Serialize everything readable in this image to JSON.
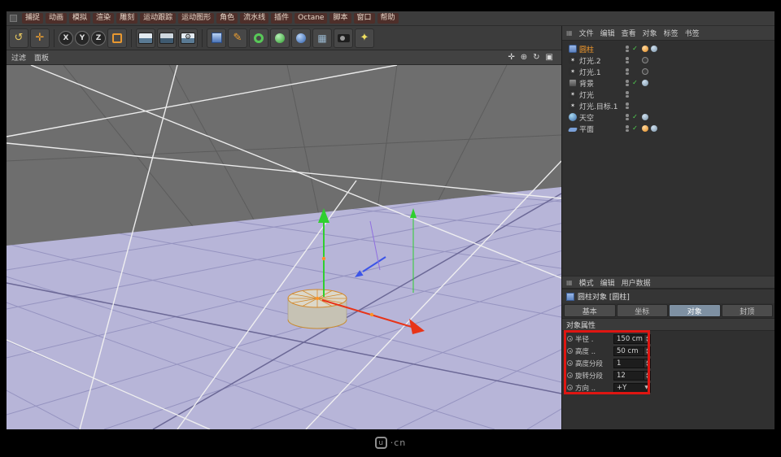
{
  "menubar": {
    "items": [
      "捕捉",
      "动画",
      "模拟",
      "渲染",
      "雕刻",
      "运动跟踪",
      "运动图形",
      "角色",
      "流水线",
      "插件",
      "Octane",
      "脚本",
      "窗口",
      "帮助"
    ]
  },
  "toolbar": {
    "axis": [
      "X",
      "Y",
      "Z"
    ],
    "icons": [
      "undo",
      "move-tool",
      "x-lock",
      "y-lock",
      "z-lock",
      "coordinate-system",
      "render-view",
      "render-region",
      "render-settings",
      "primitive-cube",
      "pen-tool",
      "spline-tool",
      "generator",
      "volume",
      "array",
      "camera",
      "light"
    ]
  },
  "viewport": {
    "menus": [
      "过滤",
      "面板"
    ],
    "nav_icons": [
      "pan",
      "zoom",
      "rotate",
      "maximize"
    ]
  },
  "object_manager": {
    "menus": [
      "文件",
      "编辑",
      "查看",
      "对象",
      "标签",
      "书签"
    ],
    "objects": [
      {
        "name": "圆柱",
        "icon": "cylinder-icon",
        "selected": true,
        "check": true,
        "tags": [
          "phong-tag",
          "compositing-tag"
        ]
      },
      {
        "name": "灯光.2",
        "icon": "light-icon",
        "check": false,
        "tags": [
          "target-tag"
        ]
      },
      {
        "name": "灯光.1",
        "icon": "light-icon",
        "check": false,
        "tags": [
          "target-tag"
        ]
      },
      {
        "name": "背景",
        "icon": "background-icon",
        "check": true,
        "tags": [
          "compositing-tag"
        ]
      },
      {
        "name": "灯光",
        "icon": "light-icon",
        "check": false,
        "tags": []
      },
      {
        "name": "灯光.目标.1",
        "icon": "light-icon",
        "check": false,
        "tags": []
      },
      {
        "name": "天空",
        "icon": "sky-icon",
        "check": true,
        "tags": [
          "compositing-tag"
        ]
      },
      {
        "name": "平面",
        "icon": "plane-icon",
        "check": true,
        "tags": [
          "phong-tag",
          "compositing-tag"
        ]
      }
    ]
  },
  "attribute_manager": {
    "menus": [
      "模式",
      "编辑",
      "用户数据"
    ],
    "title": "圆柱对象 [圆柱]",
    "tabs": [
      {
        "label": "基本",
        "active": false
      },
      {
        "label": "坐标",
        "active": false
      },
      {
        "label": "对象",
        "active": true
      },
      {
        "label": "封顶",
        "active": false
      }
    ],
    "section": "对象属性",
    "properties": [
      {
        "label": "半径 .",
        "value": "150 cm",
        "type": "number"
      },
      {
        "label": "高度 ..",
        "value": "50 cm",
        "type": "number"
      },
      {
        "label": "高度分段",
        "value": "1",
        "type": "number"
      },
      {
        "label": "旋转分段",
        "value": "12",
        "type": "number"
      },
      {
        "label": "方向 ..",
        "value": "+Y",
        "type": "select"
      }
    ]
  },
  "icons": {
    "undo": "↺",
    "move": "✛",
    "gear": "⚙",
    "pen": "✎",
    "grid": "▦",
    "light": "✦",
    "pan": "✛",
    "zoom": "⊕",
    "rotate": "↻",
    "maximize": "▣",
    "check": "✓",
    "dropdown": "▼",
    "stepper_up": "▴",
    "stepper_down": "▾",
    "panel_menu": "▦",
    "light_object": "✶"
  },
  "colors": {
    "selected_object": "#f59a2c",
    "highlight_red": "#de1612",
    "ground_plane": "#b7b5d8",
    "tab_active": "#7e90a2"
  },
  "watermark": {
    "logo_letter": "u",
    "suffix": "·cn"
  }
}
